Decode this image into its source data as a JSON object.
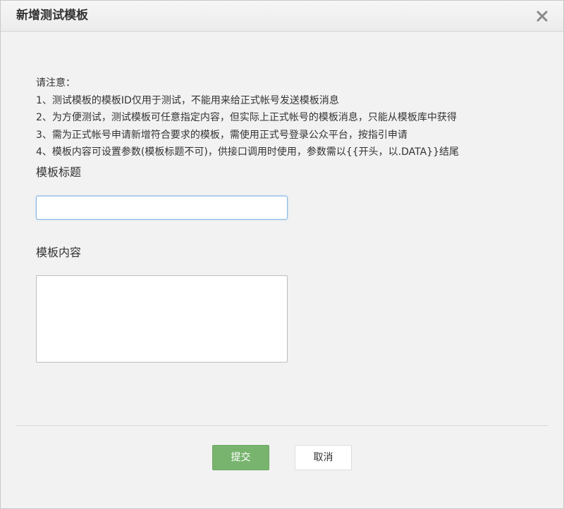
{
  "dialog": {
    "title": "新增测试模板",
    "close_icon": "close-icon"
  },
  "notice": {
    "heading": "请注意：",
    "lines": [
      "1、测试模板的模板ID仅用于测试，不能用来给正式帐号发送模板消息",
      "2、为方便测试，测试模板可任意指定内容，但实际上正式帐号的模板消息，只能从模板库中获得",
      "3、需为正式帐号申请新增符合要求的模板，需使用正式号登录公众平台，按指引申请",
      "4、模板内容可设置参数(模板标题不可)，供接口调用时使用，参数需以{{开头，以.DATA}}结尾"
    ]
  },
  "form": {
    "title_label": "模板标题",
    "title_value": "",
    "content_label": "模板内容",
    "content_value": ""
  },
  "buttons": {
    "submit_label": "提交",
    "cancel_label": "取消"
  },
  "colors": {
    "submit_bg": "#78b46e",
    "focus_border": "#86b7e6"
  }
}
